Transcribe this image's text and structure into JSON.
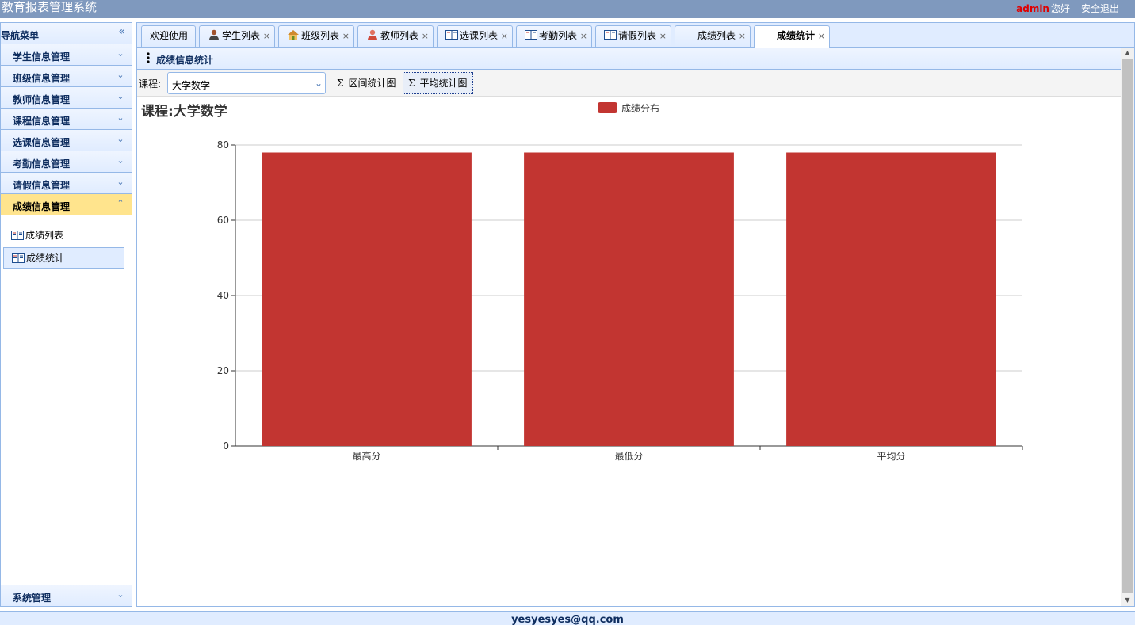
{
  "app": {
    "title": "教育报表管理系统",
    "user": "admin",
    "greeting": "您好",
    "logout": "安全退出"
  },
  "nav": {
    "header": "导航菜单",
    "items": [
      {
        "label": "学生信息管理"
      },
      {
        "label": "班级信息管理"
      },
      {
        "label": "教师信息管理"
      },
      {
        "label": "课程信息管理"
      },
      {
        "label": "选课信息管理"
      },
      {
        "label": "考勤信息管理"
      },
      {
        "label": "请假信息管理"
      },
      {
        "label": "成绩信息管理"
      }
    ],
    "sub_items": [
      {
        "label": "成绩列表"
      },
      {
        "label": "成绩统计"
      }
    ],
    "bottom": {
      "label": "系统管理"
    }
  },
  "tabs": [
    {
      "label": "欢迎使用"
    },
    {
      "label": "学生列表"
    },
    {
      "label": "班级列表"
    },
    {
      "label": "教师列表"
    },
    {
      "label": "选课列表"
    },
    {
      "label": "考勤列表"
    },
    {
      "label": "请假列表"
    },
    {
      "label": "成绩列表"
    },
    {
      "label": "成绩统计"
    }
  ],
  "panel": {
    "title": "成绩信息统计"
  },
  "toolbar": {
    "course_label": "课程:",
    "course_value": "大学数学",
    "btn_range": "区间统计图",
    "btn_avg": "平均统计图"
  },
  "chart_data": {
    "type": "bar",
    "title": "课程:大学数学",
    "categories": [
      "最高分",
      "最低分",
      "平均分"
    ],
    "series": [
      {
        "name": "成绩分布",
        "values": [
          78,
          78,
          78
        ]
      }
    ],
    "ylim": [
      0,
      80
    ],
    "yticks": [
      0,
      20,
      40,
      60,
      80
    ],
    "grid": true,
    "legend": "top-center",
    "color": "#c23531"
  },
  "footer": {
    "text": "yesyesyes@qq.com"
  }
}
